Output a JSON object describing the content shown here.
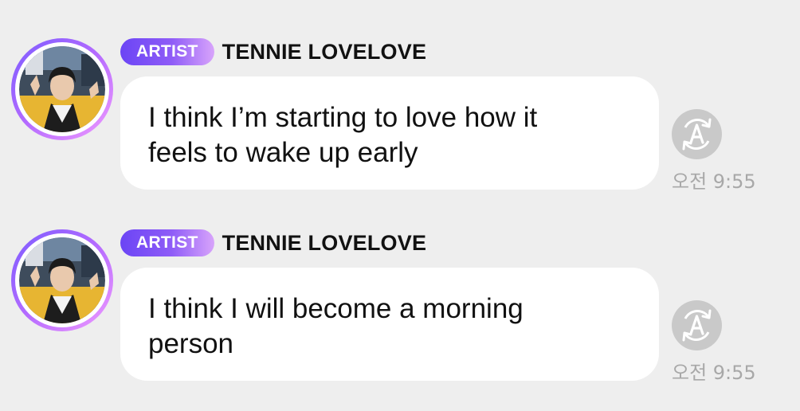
{
  "messages": [
    {
      "badge": "ARTIST",
      "sender": "TENNIE LOVELOVE",
      "text_lines": [
        "I think I’m starting to love how it",
        "feels to wake up early"
      ],
      "time": "오전 9:55",
      "translate_icon": "translate-a-icon",
      "avatar": "artist-avatar"
    },
    {
      "badge": "ARTIST",
      "sender": "TENNIE LOVELOVE",
      "text_lines": [
        "I think I will become a morning",
        "person"
      ],
      "time": "오전 9:55",
      "translate_icon": "translate-a-icon",
      "avatar": "artist-avatar"
    }
  ],
  "colors": {
    "background": "#eeeeee",
    "bubble": "#ffffff",
    "badge_start": "#6b45f5",
    "badge_end": "#d8a4fb",
    "translate_button": "#c9c9c9",
    "time_text": "#a8a8a8"
  }
}
